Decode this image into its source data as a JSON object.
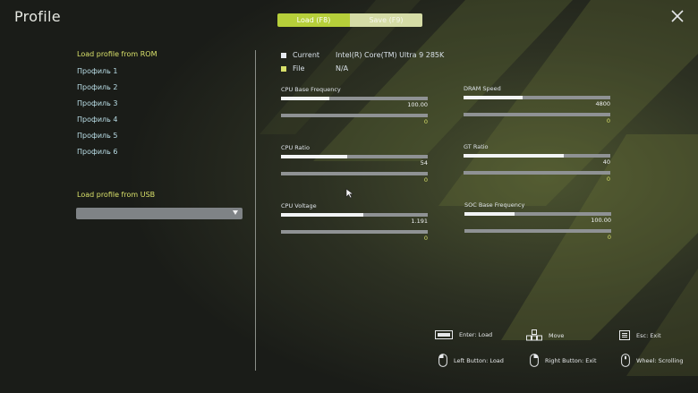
{
  "window": {
    "title": "Profile"
  },
  "tabs": [
    {
      "label": "Load (F8)",
      "active": true
    },
    {
      "label": "Save (F9)",
      "active": false
    }
  ],
  "rom": {
    "header": "Load profile from ROM",
    "profiles": [
      "Профиль 1",
      "Профиль 2",
      "Профиль 3",
      "Профиль 4",
      "Профиль 5",
      "Профиль 6"
    ]
  },
  "usb": {
    "header": "Load profile from USB",
    "selected": ""
  },
  "info": {
    "current": {
      "label": "Current",
      "value": "Intel(R) Core(TM) Ultra 9 285K",
      "color": "#e6eaf0"
    },
    "file": {
      "label": "File",
      "value": "N/A",
      "color": "#d8e06a"
    }
  },
  "params": [
    {
      "label": "CPU Base Frequency",
      "value": "100.00",
      "file_value": "0",
      "level": 0.33
    },
    {
      "label": "DRAM Speed",
      "value": "4800",
      "file_value": "0",
      "level": 0.4
    },
    {
      "label": "CPU Ratio",
      "value": "54",
      "file_value": "0",
      "level": 0.45
    },
    {
      "label": "GT Ratio",
      "value": "40",
      "file_value": "0",
      "level": 0.68
    },
    {
      "label": "CPU Voltage",
      "value": "1.191",
      "file_value": "0",
      "level": 0.56
    },
    {
      "label": "SOC Base Frequency",
      "value": "100.00",
      "file_value": "0",
      "level": 0.34
    }
  ],
  "help": [
    {
      "label": "Enter: Load",
      "icon": "enter-key-icon"
    },
    {
      "label": "Move",
      "icon": "arrow-keys-icon"
    },
    {
      "label": "Esc: Exit",
      "icon": "esc-key-icon"
    },
    {
      "label": "Left Button: Load",
      "icon": "mouse-left-icon"
    },
    {
      "label": "Right Button: Exit",
      "icon": "mouse-right-icon"
    },
    {
      "label": "Wheel: Scrolling",
      "icon": "mouse-wheel-icon"
    }
  ],
  "colors": {
    "accent": "#b6cf3a",
    "highlight": "#d8e06a",
    "list_text": "#b9dde6"
  }
}
